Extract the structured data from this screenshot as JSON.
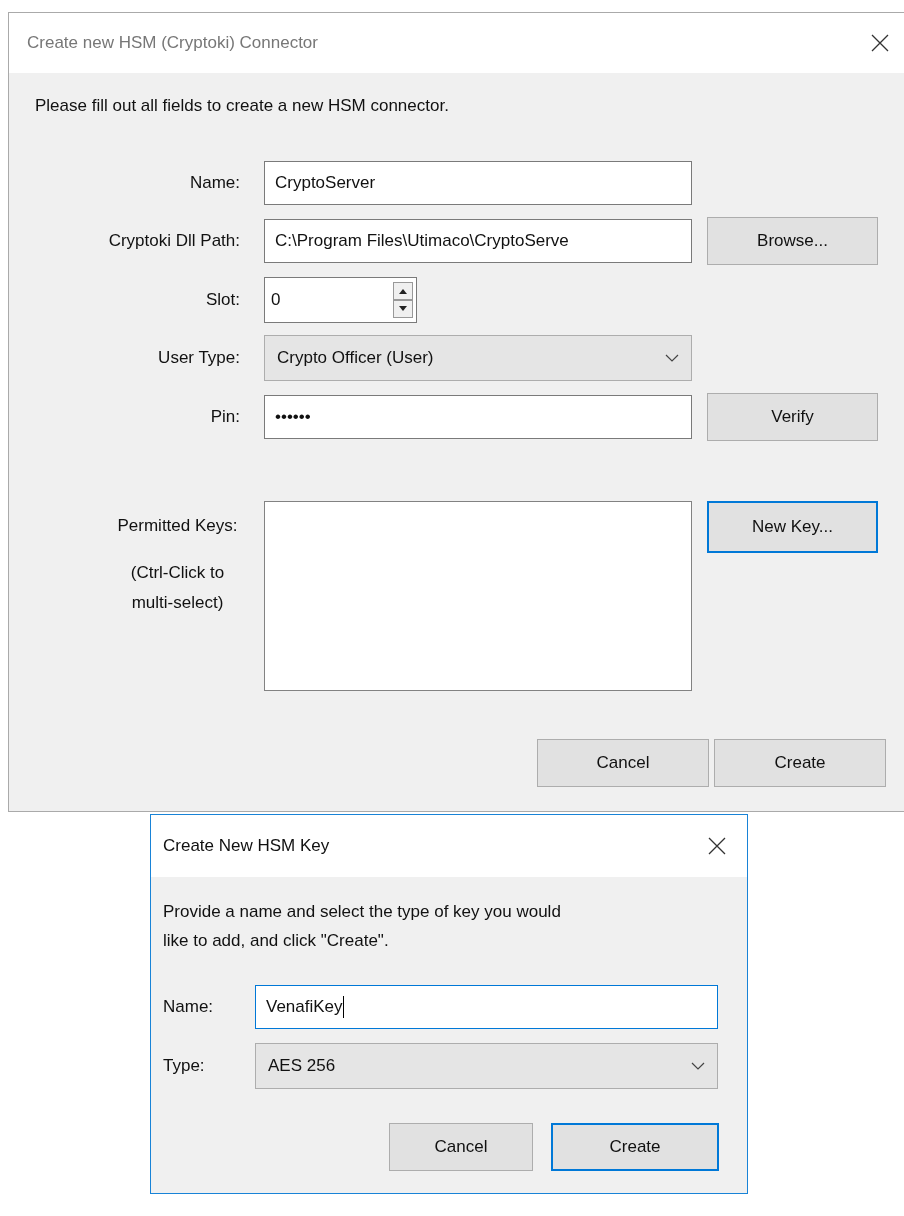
{
  "main_dialog": {
    "title": "Create new HSM (Cryptoki) Connector",
    "instruction": "Please fill out all fields to create a new HSM connector.",
    "fields": [
      {
        "kind": "text",
        "label": "Name:",
        "value": "CryptoServer"
      },
      {
        "kind": "text",
        "label": "Cryptoki Dll Path:",
        "value": "C:\\Program Files\\Utimaco\\CryptoServe",
        "button": "Browse..."
      },
      {
        "kind": "spinner",
        "label": "Slot:",
        "value": "0"
      },
      {
        "kind": "dropdown",
        "label": "User Type:",
        "value": "Crypto Officer (User)"
      },
      {
        "kind": "password",
        "label": "Pin:",
        "value": "••••••",
        "button": "Verify"
      }
    ],
    "keys_list": {
      "label": "Permitted Keys:",
      "hint": "(Ctrl-Click to multi-select)",
      "button": "New Key...",
      "button_focused": true
    },
    "buttons": [
      {
        "label": "Cancel",
        "default": false
      },
      {
        "label": "Create",
        "default": false
      }
    ]
  },
  "key_dialog": {
    "title": "Create New HSM Key",
    "instruction": "Provide a name and select the type of key you would like to add, and click \"Create\".",
    "fields": [
      {
        "kind": "text",
        "label": "Name:",
        "value": "VenafiKey",
        "focused": true
      },
      {
        "kind": "dropdown",
        "label": "Type:",
        "value": "AES 256",
        "focused": false
      }
    ],
    "buttons": [
      {
        "label": "Cancel",
        "default": false
      },
      {
        "label": "Create",
        "default": true
      }
    ]
  }
}
